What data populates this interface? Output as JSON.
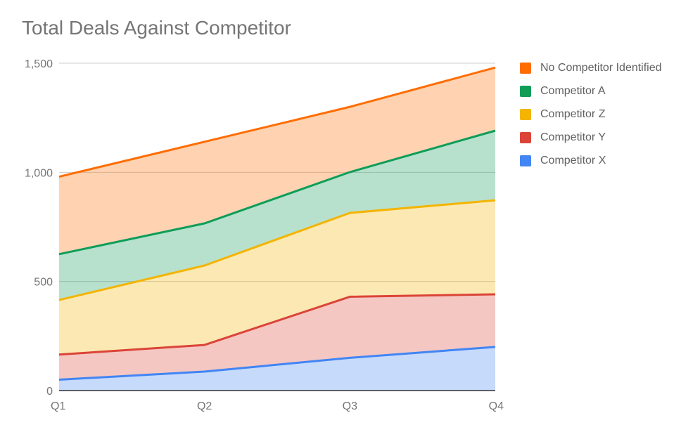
{
  "chart_data": {
    "type": "area",
    "stacked": true,
    "title": "Total Deals Against Competitor",
    "xlabel": "",
    "ylabel": "",
    "categories": [
      "Q1",
      "Q2",
      "Q3",
      "Q4"
    ],
    "ylim": [
      0,
      1500
    ],
    "yticks": [
      0,
      500,
      1000,
      1500
    ],
    "ytick_labels": [
      "0",
      "500",
      "1,000",
      "1,500"
    ],
    "grid": true,
    "legend_position": "right",
    "series": [
      {
        "name": "Competitor X",
        "color": "#4285F4",
        "values": [
          50,
          87,
          150,
          200
        ]
      },
      {
        "name": "Competitor Y",
        "color": "#DB4437",
        "values": [
          115,
          122,
          280,
          241
        ]
      },
      {
        "name": "Competitor Z",
        "color": "#F4B400",
        "values": [
          250,
          364,
          384,
          431
        ]
      },
      {
        "name": "Competitor A",
        "color": "#0F9D58",
        "values": [
          210,
          193,
          187,
          319
        ]
      },
      {
        "name": "No Competitor Identified",
        "color": "#FF6D01",
        "values": [
          355,
          374,
          299,
          289
        ]
      }
    ]
  },
  "legend": {
    "items": [
      {
        "label": "No Competitor Identified",
        "color": "#FF6D01"
      },
      {
        "label": "Competitor A",
        "color": "#0F9D58"
      },
      {
        "label": "Competitor Z",
        "color": "#F4B400"
      },
      {
        "label": "Competitor Y",
        "color": "#DB4437"
      },
      {
        "label": "Competitor X",
        "color": "#4285F4"
      }
    ]
  }
}
